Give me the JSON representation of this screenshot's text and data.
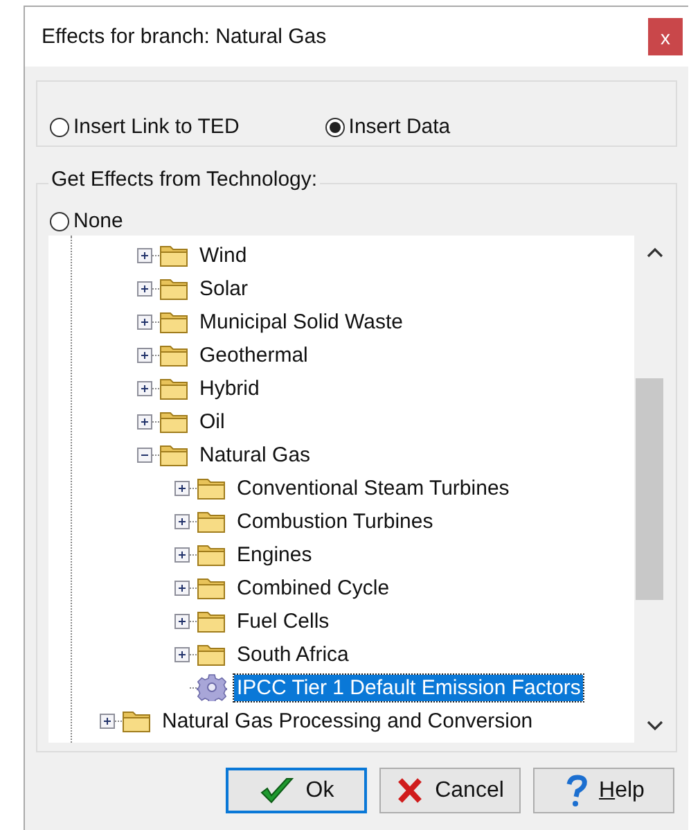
{
  "window": {
    "title": "Effects for branch: Natural Gas",
    "close": "x"
  },
  "source": {
    "options": [
      {
        "label": "Insert Link to TED",
        "selected": false
      },
      {
        "label": "Insert Data",
        "selected": true
      }
    ]
  },
  "technology": {
    "legend": "Get Effects from Technology:",
    "none": {
      "label": "None",
      "selected": false
    },
    "tree": {
      "nodes": [
        {
          "children": [
            {
              "label": "Wind",
              "kind": "folder",
              "expanded": false,
              "selected": false
            },
            {
              "label": "Solar",
              "kind": "folder",
              "expanded": false,
              "selected": false
            },
            {
              "label": "Municipal Solid Waste",
              "kind": "folder",
              "expanded": false,
              "selected": false
            },
            {
              "label": "Geothermal",
              "kind": "folder",
              "expanded": false,
              "selected": false
            },
            {
              "label": "Hybrid",
              "kind": "folder",
              "expanded": false,
              "selected": false
            },
            {
              "label": "Oil",
              "kind": "folder",
              "expanded": false,
              "selected": false
            },
            {
              "label": "Natural Gas",
              "kind": "folder",
              "expanded": true,
              "selected": false,
              "children": [
                {
                  "label": "Conventional Steam Turbines",
                  "kind": "folder",
                  "expanded": false,
                  "selected": false
                },
                {
                  "label": "Combustion Turbines",
                  "kind": "folder",
                  "expanded": false,
                  "selected": false
                },
                {
                  "label": "Engines",
                  "kind": "folder",
                  "expanded": false,
                  "selected": false
                },
                {
                  "label": "Combined Cycle",
                  "kind": "folder",
                  "expanded": false,
                  "selected": false
                },
                {
                  "label": "Fuel Cells",
                  "kind": "folder",
                  "expanded": false,
                  "selected": false
                },
                {
                  "label": "South Africa",
                  "kind": "folder",
                  "expanded": false,
                  "selected": false
                },
                {
                  "label": "IPCC Tier 1 Default Emission Factors",
                  "kind": "technology",
                  "selected": true
                }
              ]
            }
          ]
        },
        {
          "label": "Natural Gas Processing and Conversion",
          "kind": "folder",
          "expanded": false,
          "selected": false
        }
      ]
    }
  },
  "buttons": [
    {
      "label": "Ok",
      "kind": "ok",
      "default": true
    },
    {
      "label": "Cancel",
      "kind": "cancel",
      "default": false
    },
    {
      "label": "Help",
      "kind": "help",
      "default": false
    }
  ]
}
